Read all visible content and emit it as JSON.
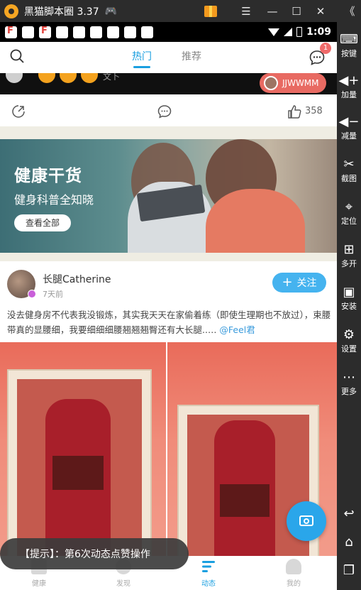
{
  "emulator": {
    "title": "黑猫脚本圈 3.37",
    "controls": {
      "gift": "gift-icon",
      "menu": "☰",
      "minimize": "—",
      "maximize": "☐",
      "close": "✕",
      "collapse": "《"
    },
    "sidebar": [
      {
        "icon": "keyboard-icon",
        "label": "按键"
      },
      {
        "icon": "volume-up-icon",
        "label": "加量"
      },
      {
        "icon": "volume-down-icon",
        "label": "减量"
      },
      {
        "icon": "scissors-icon",
        "label": "截图"
      },
      {
        "icon": "location-icon",
        "label": "定位"
      },
      {
        "icon": "multi-open-icon",
        "label": "多开"
      },
      {
        "icon": "apk-icon",
        "label": "安装"
      },
      {
        "icon": "settings-icon",
        "label": "设置"
      },
      {
        "icon": "more-icon",
        "label": "更多"
      }
    ]
  },
  "status_bar": {
    "time": "1:09"
  },
  "app": {
    "tabs": {
      "hot": "热门",
      "recommend": "推荐"
    },
    "message_badge": "1",
    "prev_card": {
      "text": "文卜",
      "chip_user": "JJWWMM",
      "like_count": "358"
    },
    "banner": {
      "title": "健康干货",
      "subtitle": "健身科普全知晓",
      "button": "查看全部"
    },
    "post": {
      "username": "长腿Catherine",
      "time": "7天前",
      "follow": "关注",
      "text": "没去健身房不代表我没锻炼，其实我天天在家偷着练（即使生理期也不放过），束腰带真的显腰细，我要细细细腰翘翘翘臀还有大长腿..… ",
      "mention": "@Feel君"
    },
    "toast": "【提示】：第6次动态点赞操作",
    "nav": [
      {
        "label": "健康",
        "icon": "health-icon"
      },
      {
        "label": "发现",
        "icon": "discover-icon"
      },
      {
        "label": "动态",
        "icon": "feed-icon",
        "active": true
      },
      {
        "label": "我的",
        "icon": "profile-icon"
      }
    ]
  },
  "colors": {
    "accent": "#1a9fe0",
    "chip": "#e86a62",
    "follow": "#45b3ef",
    "emulator": "#2c2c2c"
  }
}
